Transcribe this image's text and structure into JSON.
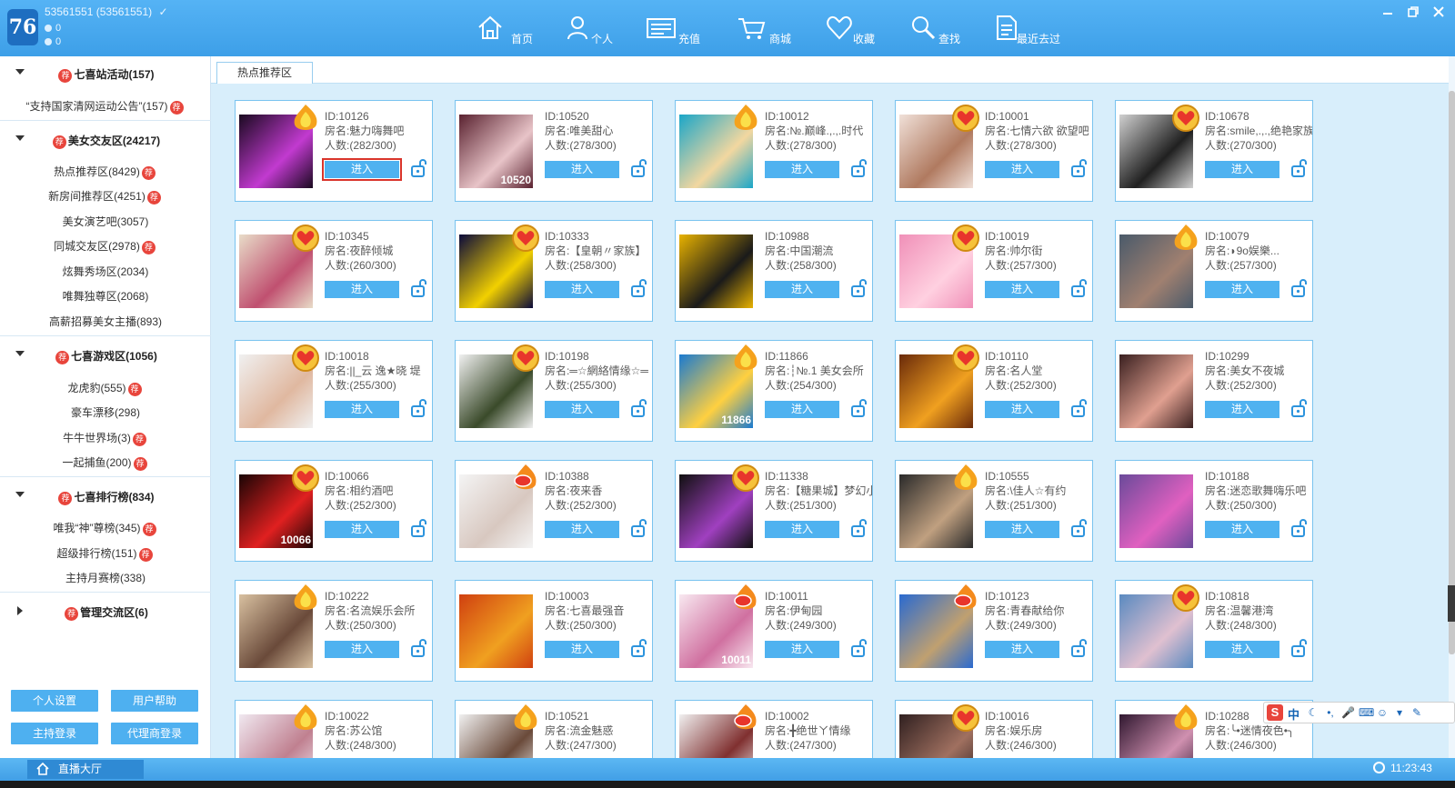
{
  "app": {
    "logo": "76",
    "user_id": "53561551 (53561551)",
    "user_check": "✓",
    "coin_a": "0",
    "coin_b": "0"
  },
  "nav": [
    {
      "label": "首页",
      "icon": "home-icon"
    },
    {
      "label": "个人",
      "icon": "person-icon"
    },
    {
      "label": "充值",
      "icon": "card-icon"
    },
    {
      "label": "商城",
      "icon": "cart-icon"
    },
    {
      "label": "收藏",
      "icon": "heart-icon"
    },
    {
      "label": "查找",
      "icon": "search-icon"
    },
    {
      "label": "最近去过",
      "icon": "document-icon"
    }
  ],
  "window_controls": [
    "minimize",
    "restore",
    "close"
  ],
  "sidebar": {
    "groups": [
      {
        "title": "七喜站活动(157)",
        "badge": "荐",
        "expanded": true,
        "items": [
          {
            "label": "“支持国家清网运动公告”(157)",
            "badge": "荐"
          }
        ]
      },
      {
        "title": "美女交友区(24217)",
        "badge": "荐",
        "expanded": true,
        "items": [
          {
            "label": "热点推荐区(8429)",
            "badge": "荐"
          },
          {
            "label": "新房间推荐区(4251)",
            "badge": "荐"
          },
          {
            "label": "美女演艺吧(3057)",
            "badge": ""
          },
          {
            "label": "同城交友区(2978)",
            "badge": "荐"
          },
          {
            "label": "炫舞秀场区(2034)",
            "badge": ""
          },
          {
            "label": "唯舞独尊区(2068)",
            "badge": ""
          },
          {
            "label": "高薪招募美女主播(893)",
            "badge": ""
          }
        ]
      },
      {
        "title": "七喜游戏区(1056)",
        "badge": "荐",
        "expanded": true,
        "items": [
          {
            "label": "龙虎豹(555)",
            "badge": "荐"
          },
          {
            "label": "豪车漂移(298)",
            "badge": ""
          },
          {
            "label": "牛牛世界场(3)",
            "badge": "荐"
          },
          {
            "label": "一起捕鱼(200)",
            "badge": "荐"
          }
        ]
      },
      {
        "title": "七喜排行榜(834)",
        "badge": "荐",
        "expanded": true,
        "items": [
          {
            "label": "唯我“神”尊榜(345)",
            "badge": "荐"
          },
          {
            "label": "超级排行榜(151)",
            "badge": "荐"
          },
          {
            "label": "主持月赛榜(338)",
            "badge": ""
          }
        ]
      },
      {
        "title": "管理交流区(6)",
        "badge": "荐",
        "expanded": false,
        "items": []
      }
    ],
    "buttons": [
      "个人设置",
      "用户帮助",
      "主持登录",
      "代理商登录"
    ]
  },
  "main": {
    "tab_label": "热点推荐区",
    "enter_label": "进入",
    "rooms": [
      {
        "id": "ID:10126",
        "name": "房名:魅力嗨舞吧",
        "count": "人数:(282/300)",
        "hot": "flame",
        "thumb": "#1a0a20",
        "thumb2": "#c23ad0",
        "mark": "",
        "selected": true
      },
      {
        "id": "ID:10520",
        "name": "房名:唯美甜心",
        "count": "人数:(278/300)",
        "hot": "",
        "thumb": "#5a2230",
        "thumb2": "#e8c4c8",
        "mark": "10520",
        "selected": false
      },
      {
        "id": "ID:10012",
        "name": "房名:№.巅峰.,.,.时代",
        "count": "人数:(278/300)",
        "hot": "flame",
        "thumb": "#1aa6c8",
        "thumb2": "#f2d7a0",
        "mark": "",
        "selected": false
      },
      {
        "id": "ID:10001",
        "name": "房名:七情六欲 欲望吧",
        "count": "人数:(278/300)",
        "hot": "heart",
        "thumb": "#f0e0d8",
        "thumb2": "#b07a60",
        "mark": "",
        "selected": false
      },
      {
        "id": "ID:10678",
        "name": "房名:smile,.,.,绝艳家族彡",
        "count": "人数:(270/300)",
        "hot": "heart",
        "thumb": "#d0d0d0",
        "thumb2": "#202020",
        "mark": "",
        "selected": false
      },
      {
        "id": "ID:10345",
        "name": "房名:夜醉倾城",
        "count": "人数:(260/300)",
        "hot": "heart",
        "thumb": "#e8dcc8",
        "thumb2": "#c05070",
        "mark": "",
        "selected": false
      },
      {
        "id": "ID:10333",
        "name": "房名:【皇朝〃家族】",
        "count": "人数:(258/300)",
        "hot": "heart",
        "thumb": "#0a0a3a",
        "thumb2": "#f2d000",
        "mark": "",
        "selected": false
      },
      {
        "id": "ID:10988",
        "name": "房名:中国潮流",
        "count": "人数:(258/300)",
        "hot": "",
        "thumb": "#e8b200",
        "thumb2": "#1a1a1a",
        "mark": "",
        "selected": false
      },
      {
        "id": "ID:10019",
        "name": "房名:帅尔街",
        "count": "人数:(257/300)",
        "hot": "heart",
        "thumb": "#f090b8",
        "thumb2": "#ffd0e0",
        "mark": "",
        "selected": false
      },
      {
        "id": "ID:10079",
        "name": "房名:◗9o娱樂...",
        "count": "人数:(257/300)",
        "hot": "flame",
        "thumb": "#4a5a6a",
        "thumb2": "#a08070",
        "mark": "",
        "selected": false
      },
      {
        "id": "ID:10018",
        "name": "房名:||_云 逸★晓 堤",
        "count": "人数:(255/300)",
        "hot": "heart",
        "thumb": "#f0f0f0",
        "thumb2": "#e0b8a0",
        "mark": "",
        "selected": false
      },
      {
        "id": "ID:10198",
        "name": "房名:═☆網絡情缘☆═",
        "count": "人数:(255/300)",
        "hot": "heart",
        "thumb": "#f0f0f0",
        "thumb2": "#3a4a2a",
        "mark": "",
        "selected": false
      },
      {
        "id": "ID:11866",
        "name": "房名:┆№.1 美女会所",
        "count": "人数:(254/300)",
        "hot": "flame",
        "thumb": "#1a7ad0",
        "thumb2": "#ffd040",
        "mark": "11866",
        "selected": false
      },
      {
        "id": "ID:10110",
        "name": "房名:名人堂",
        "count": "人数:(252/300)",
        "hot": "heart",
        "thumb": "#6a2a0a",
        "thumb2": "#f0a020",
        "mark": "",
        "selected": false
      },
      {
        "id": "ID:10299",
        "name": "房名:美女不夜城",
        "count": "人数:(252/300)",
        "hot": "",
        "thumb": "#3a2020",
        "thumb2": "#e0a090",
        "mark": "",
        "selected": false
      },
      {
        "id": "ID:10066",
        "name": "房名:相约酒吧",
        "count": "人数:(252/300)",
        "hot": "heart",
        "thumb": "#1a0505",
        "thumb2": "#e02020",
        "mark": "10066",
        "selected": false
      },
      {
        "id": "ID:10388",
        "name": "房名:夜来香",
        "count": "人数:(252/300)",
        "hot": "hot",
        "thumb": "#f4f4f4",
        "thumb2": "#d8c8c0",
        "mark": "",
        "selected": false
      },
      {
        "id": "ID:11338",
        "name": "房名:【糖果城】梦幻小屋",
        "count": "人数:(251/300)",
        "hot": "heart",
        "thumb": "#101010",
        "thumb2": "#a040c0",
        "mark": "",
        "selected": false
      },
      {
        "id": "ID:10555",
        "name": "房名:\\佳人☆有约",
        "count": "人数:(251/300)",
        "hot": "flame",
        "thumb": "#2a2a2a",
        "thumb2": "#c0a080",
        "mark": "",
        "selected": false
      },
      {
        "id": "ID:10188",
        "name": "房名:迷恋歌舞嗨乐吧",
        "count": "人数:(250/300)",
        "hot": "",
        "thumb": "#6a4a9a",
        "thumb2": "#e060c0",
        "mark": "",
        "selected": false
      },
      {
        "id": "ID:10222",
        "name": "房名:名流娱乐会所",
        "count": "人数:(250/300)",
        "hot": "flame",
        "thumb": "#d8c0a0",
        "thumb2": "#6a4a3a",
        "mark": "",
        "selected": false
      },
      {
        "id": "ID:10003",
        "name": "房名:七喜最强音",
        "count": "人数:(250/300)",
        "hot": "",
        "thumb": "#d04010",
        "thumb2": "#f0a020",
        "mark": "",
        "selected": false
      },
      {
        "id": "ID:10011",
        "name": "房名:伊甸园",
        "count": "人数:(249/300)",
        "hot": "hot",
        "thumb": "#f8e8f0",
        "thumb2": "#d070a0",
        "mark": "10011",
        "selected": false
      },
      {
        "id": "ID:10123",
        "name": "房名:青春献给你",
        "count": "人数:(249/300)",
        "hot": "hot",
        "thumb": "#2a6ad0",
        "thumb2": "#c0a070",
        "mark": "",
        "selected": false
      },
      {
        "id": "ID:10818",
        "name": "房名:温馨港湾",
        "count": "人数:(248/300)",
        "hot": "heart",
        "thumb": "#5a8ac0",
        "thumb2": "#e0c0d0",
        "mark": "",
        "selected": false
      },
      {
        "id": "ID:10022",
        "name": "房名:苏公馆",
        "count": "人数:(248/300)",
        "hot": "flame",
        "thumb": "#f0e8f0",
        "thumb2": "#c08090",
        "mark": "",
        "selected": false
      },
      {
        "id": "ID:10521",
        "name": "房名:流金魅惑",
        "count": "人数:(247/300)",
        "hot": "flame",
        "thumb": "#f0f0f0",
        "thumb2": "#6a4a3a",
        "mark": "",
        "selected": false
      },
      {
        "id": "ID:10002",
        "name": "房名:╋绝世ㄚ情缘",
        "count": "人数:(247/300)",
        "hot": "hot",
        "thumb": "#f0f0f0",
        "thumb2": "#803030",
        "mark": "",
        "selected": false
      },
      {
        "id": "ID:10016",
        "name": "房名:娱乐房",
        "count": "人数:(246/300)",
        "hot": "heart",
        "thumb": "#302020",
        "thumb2": "#a07060",
        "mark": "",
        "selected": false
      },
      {
        "id": "ID:10288",
        "name": "房名:╰•迷情夜色•╮",
        "count": "人数:(246/300)",
        "hot": "flame",
        "thumb": "#301830",
        "thumb2": "#d090b0",
        "mark": "",
        "selected": false
      }
    ]
  },
  "ime": {
    "logo": "S",
    "mode": "中"
  },
  "bottom": {
    "hall_label": "直播大厅",
    "time": "11:23:43"
  }
}
